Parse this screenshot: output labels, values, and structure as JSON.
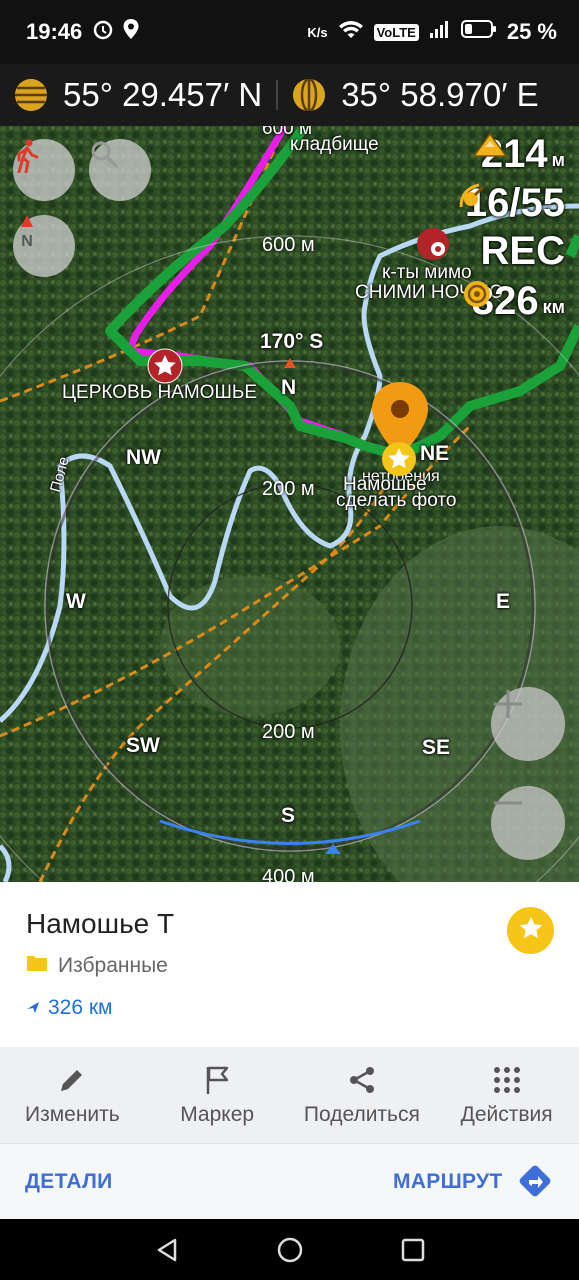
{
  "status_bar": {
    "time": "19:46",
    "net_speed": "K/s",
    "volte": "VoLTE",
    "battery": "25 %"
  },
  "coords": {
    "lat": "55° 29.457′ N",
    "lon": "35° 58.970′ E"
  },
  "overlay": {
    "altitude": "214",
    "altitude_unit": "м",
    "satellites": "16/55",
    "rec": "REC",
    "distance": "326",
    "distance_unit": "км"
  },
  "map": {
    "label_cemetery_top": "600 м",
    "label_cemetery": "кладбище",
    "ring_600": "600 м",
    "poi_kt": "к-ты мимо",
    "poi_snimi": "СНИМИ НОЧЬЮ",
    "heading": "170° S",
    "church": "ЦЕРКОВЬ НАМОШЬЕ",
    "poi_note1": "Намошье",
    "poi_note2": "сделать фото",
    "poi_note_pre": "нетроения",
    "ring_200_top": "200 м",
    "ring_200_bottom": "200 м",
    "ring_400": "400 м",
    "compass": {
      "N": "N",
      "NE": "NE",
      "E": "E",
      "SE": "SE",
      "S": "S",
      "SW": "SW",
      "W": "W",
      "NW": "NW"
    },
    "river": "Поле"
  },
  "card": {
    "title": "Намошье Т",
    "folder": "Избранные",
    "distance": "326 км"
  },
  "actions": [
    {
      "label": "Изменить",
      "icon": "pencil-icon"
    },
    {
      "label": "Маркер",
      "icon": "flag-icon"
    },
    {
      "label": "Поделиться",
      "icon": "share-icon"
    },
    {
      "label": "Действия",
      "icon": "grid-dots-icon"
    }
  ],
  "links": {
    "details": "ДЕТАЛИ",
    "route": "МАРШРУТ"
  },
  "colors": {
    "track_green": "#1aa13a",
    "track_magenta": "#e81ee8",
    "river": "#b8d8f5",
    "accent_blue": "#3f6fd6",
    "favorite_yellow": "#f5c518",
    "marker_orange": "#f29a12"
  }
}
